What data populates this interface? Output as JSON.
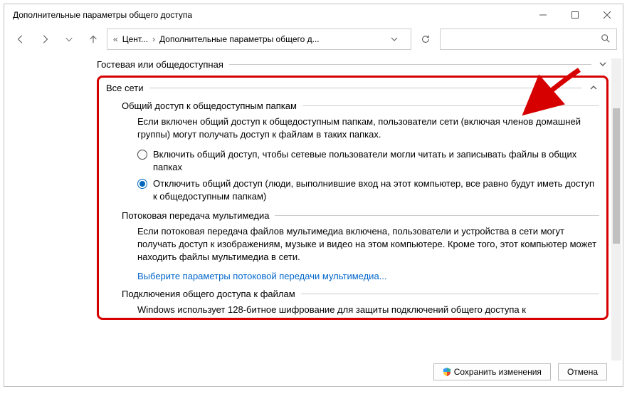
{
  "window": {
    "title": "Дополнительные параметры общего доступа"
  },
  "nav": {
    "crumb1": "Цент...",
    "crumb2": "Дополнительные параметры общего д..."
  },
  "search": {
    "placeholder": ""
  },
  "sections": {
    "guest_label": "Гостевая или общедоступная",
    "all_networks_label": "Все сети"
  },
  "public_folders": {
    "heading": "Общий доступ к общедоступным папкам",
    "desc": "Если включен общий доступ к общедоступным папкам, пользователи сети (включая членов домашней группы) могут получать доступ к файлам в таких папках.",
    "opt_on": "Включить общий доступ, чтобы сетевые пользователи могли читать и записывать файлы в общих папках",
    "opt_off": "Отключить общий доступ (люди, выполнившие вход на этот компьютер, все равно будут иметь доступ к общедоступным папкам)"
  },
  "media": {
    "heading": "Потоковая передача мультимедиа",
    "desc": "Если потоковая передача файлов мультимедиа включена, пользователи и устройства в сети могут получать доступ к изображениям, музыке и видео на этом компьютере. Кроме того, этот компьютер может находить файлы мультимедиа в сети.",
    "link": "Выберите параметры потоковой передачи мультимедиа..."
  },
  "file_conn": {
    "heading": "Подключения общего доступа к файлам",
    "desc": "Windows использует 128-битное шифрование для защиты подключений общего доступа к"
  },
  "buttons": {
    "save": "Сохранить изменения",
    "cancel": "Отмена"
  }
}
